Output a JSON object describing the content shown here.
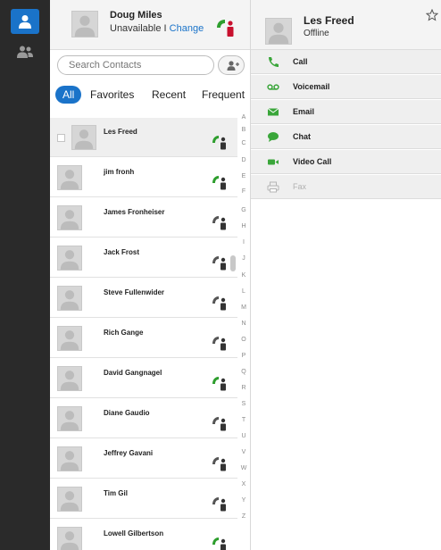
{
  "current_user": {
    "name": "Doug Miles",
    "status": "Unavailable",
    "separator": " I ",
    "change_link": "Change",
    "phone_state": "busy"
  },
  "search": {
    "placeholder": "Search Contacts"
  },
  "tabs": [
    {
      "label": "All",
      "active": true
    },
    {
      "label": "Favorites",
      "active": false
    },
    {
      "label": "Recent",
      "active": false
    },
    {
      "label": "Frequent",
      "active": false
    }
  ],
  "contacts": [
    {
      "name": "Les Freed",
      "status": "available",
      "selected": true
    },
    {
      "name": "jim fronh",
      "status": "available"
    },
    {
      "name": "James Fronheiser",
      "status": "offline"
    },
    {
      "name": "Jack Frost",
      "status": "offline"
    },
    {
      "name": "Steve Fullenwider",
      "status": "offline"
    },
    {
      "name": "Rich Gange",
      "status": "offline"
    },
    {
      "name": "David Gangnagel",
      "status": "available"
    },
    {
      "name": "Diane Gaudio",
      "status": "offline"
    },
    {
      "name": "Jeffrey Gavani",
      "status": "offline"
    },
    {
      "name": "Tim Gil",
      "status": "offline"
    },
    {
      "name": "Lowell Gilbertson",
      "status": "available"
    }
  ],
  "alphabet": [
    "A",
    "B",
    "C",
    "D",
    "E",
    "F",
    "G",
    "H",
    "I",
    "J",
    "K",
    "L",
    "M",
    "N",
    "O",
    "P",
    "Q",
    "R",
    "S",
    "T",
    "U",
    "V",
    "W",
    "X",
    "Y",
    "Z"
  ],
  "detail": {
    "name": "Les Freed",
    "status": "Offline",
    "actions": [
      {
        "label": "Call",
        "icon": "phone-icon",
        "enabled": true
      },
      {
        "label": "Voicemail",
        "icon": "voicemail-icon",
        "enabled": true
      },
      {
        "label": "Email",
        "icon": "email-icon",
        "enabled": true
      },
      {
        "label": "Chat",
        "icon": "chat-icon",
        "enabled": true
      },
      {
        "label": "Video Call",
        "icon": "video-icon",
        "enabled": true
      },
      {
        "label": "Fax",
        "icon": "fax-icon",
        "enabled": false
      }
    ]
  },
  "colors": {
    "accent": "#1a73c9",
    "available": "#2e9e2e",
    "busy": "#c8102e",
    "offline": "#555555",
    "action_icon": "#3aa63a"
  }
}
